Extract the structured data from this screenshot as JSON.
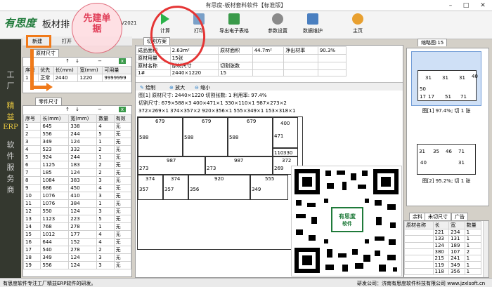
{
  "window": {
    "title": "有思度-板材套料软件【标准版】"
  },
  "brand": {
    "logo": "有思度",
    "name": "板材排",
    "version": "V2021"
  },
  "toolbar": {
    "calc": "计算",
    "print": "打印",
    "export": "导出电子表格",
    "params": "参数设置",
    "data": "数据维护",
    "home": "主页"
  },
  "annotation": {
    "bubble_line1": "先建单",
    "bubble_line2": "据"
  },
  "left_toolbar": {
    "new": "新建",
    "open": "打开"
  },
  "sidebar": {
    "chars": [
      "工",
      "厂",
      "精",
      "益",
      "ERP",
      "软",
      "件",
      "服",
      "务",
      "商"
    ]
  },
  "board_tab": "原材尺寸",
  "board_table": {
    "headers": [
      "序号",
      "优先",
      "长(mm)",
      "宽(mm)",
      "可用量"
    ],
    "rows": [
      [
        "1",
        "正常",
        "2440",
        "1220",
        "9999999"
      ]
    ]
  },
  "parts_tab": "零件尺寸",
  "parts_table": {
    "headers": [
      "序号",
      "长(mm)",
      "宽(mm)",
      "数量",
      "有效"
    ],
    "rows": [
      [
        "1",
        "645",
        "338",
        "4",
        "无"
      ],
      [
        "2",
        "556",
        "244",
        "5",
        "无"
      ],
      [
        "3",
        "349",
        "124",
        "1",
        "无"
      ],
      [
        "4",
        "523",
        "332",
        "2",
        "无"
      ],
      [
        "5",
        "924",
        "244",
        "1",
        "无"
      ],
      [
        "6",
        "1125",
        "183",
        "2",
        "无"
      ],
      [
        "7",
        "185",
        "124",
        "2",
        "无"
      ],
      [
        "8",
        "1084",
        "383",
        "3",
        "无"
      ],
      [
        "9",
        "686",
        "450",
        "4",
        "无"
      ],
      [
        "10",
        "1076",
        "410",
        "3",
        "无"
      ],
      [
        "11",
        "1076",
        "384",
        "1",
        "无"
      ],
      [
        "12",
        "550",
        "124",
        "3",
        "无"
      ],
      [
        "13",
        "1123",
        "223",
        "5",
        "无"
      ],
      [
        "14",
        "768",
        "278",
        "1",
        "无"
      ],
      [
        "15",
        "1012",
        "177",
        "4",
        "无"
      ],
      [
        "16",
        "644",
        "152",
        "4",
        "无"
      ],
      [
        "17",
        "540",
        "278",
        "2",
        "无"
      ],
      [
        "18",
        "349",
        "124",
        "3",
        "无"
      ],
      [
        "19",
        "556",
        "124",
        "3",
        "无"
      ]
    ]
  },
  "plan_tab": "切割方案",
  "plan_info": {
    "r1": [
      "成品面积",
      "2.63m²",
      "原材面积",
      "44.7m²",
      "净出材率",
      "90.3%"
    ],
    "r2": [
      "原材用量",
      "15张",
      "",
      "",
      "",
      ""
    ],
    "r3": [
      "原材名称",
      "原材尺寸",
      "切割张数",
      "",
      "",
      ""
    ],
    "r4": [
      "1#",
      "2440×1220",
      "15",
      "",
      "",
      ""
    ]
  },
  "plan_toolbar": {
    "draw": "绘制",
    "zoom_in": "放大",
    "zoom_out": "缩小"
  },
  "plan_text": {
    "l1": "图[1] 原材尺寸: 2440×1220  切割张数: 1  利用率: 97.4%",
    "l2": "切割尺寸: 679×588×3  400×471×1  330×110×1  987×273×2",
    "l3": "372×269×1  374×357×2  920×356×1  555×349×1  153×318×1"
  },
  "layout_labels": {
    "a": "679",
    "b": "588",
    "c": "679",
    "d": "588",
    "e": "679",
    "f": "588",
    "g": "400",
    "h": "471",
    "i": "110",
    "j": "330",
    "k": "987",
    "l": "273",
    "m": "987",
    "n": "273",
    "o": "372",
    "p": "269",
    "q": "374",
    "r": "357",
    "s": "374",
    "t": "357",
    "u": "920",
    "v": "356",
    "w": "555",
    "x": "349"
  },
  "qr": {
    "logo": "有思度",
    "sub": "软件"
  },
  "thumbs": {
    "tab": "缩略图:15",
    "cap1": "图[1] 97.4%; 切 1 张",
    "cap2": "图[2] 95.2%; 切 1 张",
    "t1": [
      "31",
      "31",
      "31",
      "40",
      "50",
      "17",
      "17",
      "51",
      "71"
    ],
    "t2": [
      "31",
      "35",
      "46",
      "71",
      "40",
      "31"
    ]
  },
  "remain": {
    "tabs": [
      "余料",
      "未切尺寸",
      "广告"
    ],
    "headers": [
      "原材名称",
      "长",
      "宽",
      "数量"
    ],
    "rows": [
      [
        "",
        "221",
        "234",
        "1"
      ],
      [
        "",
        "133",
        "131",
        "1"
      ],
      [
        "",
        "124",
        "189",
        "1"
      ],
      [
        "",
        "380",
        "107",
        "2"
      ],
      [
        "",
        "215",
        "241",
        "1"
      ],
      [
        "",
        "119",
        "349",
        "1"
      ],
      [
        "",
        "118",
        "356",
        "1"
      ]
    ]
  },
  "status": {
    "left": "有思度软件专注工厂精益ERP软件的研发。",
    "right": "研发公司：济南有思度软件科技有限公司  www.jzxlsoft.cn"
  }
}
